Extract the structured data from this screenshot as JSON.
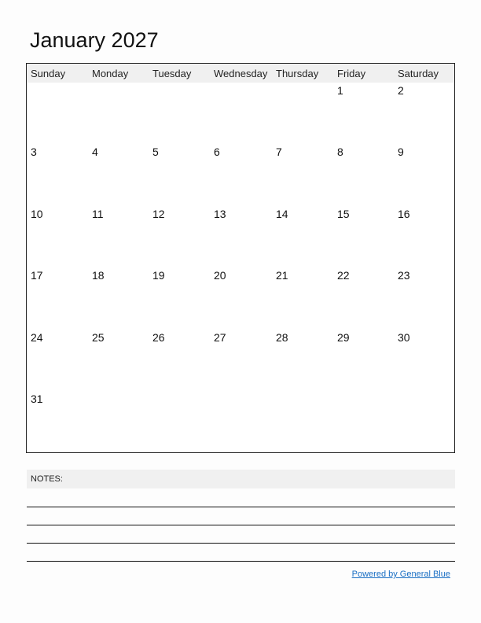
{
  "title": "January 2027",
  "weekdays": [
    "Sunday",
    "Monday",
    "Tuesday",
    "Wednesday",
    "Thursday",
    "Friday",
    "Saturday"
  ],
  "weeks": [
    [
      "",
      "",
      "",
      "",
      "",
      "1",
      "2"
    ],
    [
      "3",
      "4",
      "5",
      "6",
      "7",
      "8",
      "9"
    ],
    [
      "10",
      "11",
      "12",
      "13",
      "14",
      "15",
      "16"
    ],
    [
      "17",
      "18",
      "19",
      "20",
      "21",
      "22",
      "23"
    ],
    [
      "24",
      "25",
      "26",
      "27",
      "28",
      "29",
      "30"
    ],
    [
      "31",
      "",
      "",
      "",
      "",
      "",
      ""
    ]
  ],
  "notes": {
    "label": "NOTES:",
    "line_count": 4
  },
  "footer": {
    "link_text": "Powered by General Blue",
    "link_color": "#1a6fc4"
  }
}
